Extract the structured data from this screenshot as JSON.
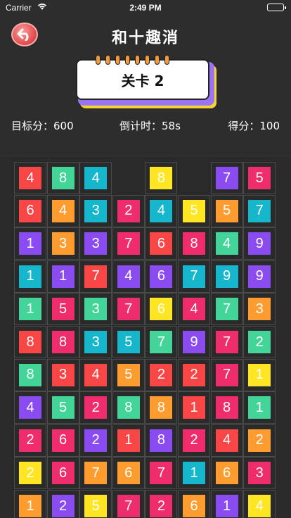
{
  "status_bar": {
    "carrier": "Carrier",
    "time": "2:49 PM"
  },
  "nav": {
    "title": "和十趣消"
  },
  "level": {
    "label": "关卡 2"
  },
  "stats": {
    "target": "目标分：600",
    "timer": "倒计时：58s",
    "score": "得分：100"
  },
  "palette": {
    "1": "#2cbce0",
    "2": "#ef2d6d",
    "3": "#ff9c2f",
    "4": "#8a4cf0",
    "5": "#43d49a",
    "6": "#f84545",
    "7": "#8a4cf0",
    "8": "#ffe522",
    "9": "#8a4cf0"
  },
  "board": {
    "rows": [
      [
        {
          "v": "4",
          "c": "#f84545"
        },
        {
          "v": "8",
          "c": "#43d49a"
        },
        {
          "v": "4",
          "c": "#16b6cc"
        },
        null,
        {
          "v": "8",
          "c": "#ffe522"
        },
        null,
        {
          "v": "7",
          "c": "#8a4cf0"
        },
        {
          "v": "5",
          "c": "#ef2d6d"
        }
      ],
      [
        {
          "v": "6",
          "c": "#f84545"
        },
        {
          "v": "4",
          "c": "#ff9c2f"
        },
        {
          "v": "3",
          "c": "#16b6cc"
        },
        {
          "v": "2",
          "c": "#ef2d6d"
        },
        {
          "v": "4",
          "c": "#16b6cc"
        },
        {
          "v": "5",
          "c": "#ffe522"
        },
        {
          "v": "5",
          "c": "#ff9c2f"
        },
        {
          "v": "7",
          "c": "#16b6cc"
        }
      ],
      [
        {
          "v": "1",
          "c": "#8a4cf0"
        },
        {
          "v": "3",
          "c": "#ff9c2f"
        },
        {
          "v": "3",
          "c": "#8a4cf0"
        },
        {
          "v": "7",
          "c": "#ef2d6d"
        },
        {
          "v": "6",
          "c": "#f84545"
        },
        {
          "v": "8",
          "c": "#ef2d6d"
        },
        {
          "v": "4",
          "c": "#43d49a"
        },
        {
          "v": "9",
          "c": "#8a4cf0"
        }
      ],
      [
        {
          "v": "1",
          "c": "#16b6cc"
        },
        {
          "v": "1",
          "c": "#8a4cf0"
        },
        {
          "v": "7",
          "c": "#f84545"
        },
        {
          "v": "4",
          "c": "#8a4cf0"
        },
        {
          "v": "6",
          "c": "#8a4cf0"
        },
        {
          "v": "7",
          "c": "#16b6cc"
        },
        {
          "v": "9",
          "c": "#16b6cc"
        },
        {
          "v": "9",
          "c": "#8a4cf0"
        }
      ],
      [
        {
          "v": "1",
          "c": "#43d49a"
        },
        {
          "v": "5",
          "c": "#ef2d6d"
        },
        {
          "v": "3",
          "c": "#43d49a"
        },
        {
          "v": "7",
          "c": "#ef2d6d"
        },
        {
          "v": "6",
          "c": "#ffe522"
        },
        {
          "v": "4",
          "c": "#ef2d6d"
        },
        {
          "v": "7",
          "c": "#43d49a"
        },
        {
          "v": "3",
          "c": "#ff9c2f"
        }
      ],
      [
        {
          "v": "8",
          "c": "#f84545"
        },
        {
          "v": "8",
          "c": "#ef2d6d"
        },
        {
          "v": "3",
          "c": "#16b6cc"
        },
        {
          "v": "5",
          "c": "#16b6cc"
        },
        {
          "v": "7",
          "c": "#43d49a"
        },
        {
          "v": "9",
          "c": "#8a4cf0"
        },
        {
          "v": "7",
          "c": "#ef2d6d"
        },
        {
          "v": "2",
          "c": "#43d49a"
        }
      ],
      [
        {
          "v": "8",
          "c": "#43d49a"
        },
        {
          "v": "3",
          "c": "#f84545"
        },
        {
          "v": "4",
          "c": "#f84545"
        },
        {
          "v": "5",
          "c": "#ff9c2f"
        },
        {
          "v": "2",
          "c": "#f84545"
        },
        {
          "v": "2",
          "c": "#f84545"
        },
        {
          "v": "7",
          "c": "#ef2d6d"
        },
        {
          "v": "1",
          "c": "#ffe522"
        }
      ],
      [
        {
          "v": "4",
          "c": "#8a4cf0"
        },
        {
          "v": "5",
          "c": "#43d49a"
        },
        {
          "v": "2",
          "c": "#ef2d6d"
        },
        {
          "v": "8",
          "c": "#43d49a"
        },
        {
          "v": "8",
          "c": "#ff9c2f"
        },
        {
          "v": "1",
          "c": "#f84545"
        },
        {
          "v": "8",
          "c": "#ef2d6d"
        },
        {
          "v": "1",
          "c": "#43d49a"
        }
      ],
      [
        {
          "v": "2",
          "c": "#ef2d6d"
        },
        {
          "v": "6",
          "c": "#ef2d6d"
        },
        {
          "v": "2",
          "c": "#8a4cf0"
        },
        {
          "v": "1",
          "c": "#f84545"
        },
        {
          "v": "8",
          "c": "#8a4cf0"
        },
        {
          "v": "2",
          "c": "#ef2d6d"
        },
        {
          "v": "4",
          "c": "#f84545"
        },
        {
          "v": "2",
          "c": "#ff9c2f"
        }
      ],
      [
        {
          "v": "2",
          "c": "#ffe522"
        },
        {
          "v": "6",
          "c": "#ef2d6d"
        },
        {
          "v": "7",
          "c": "#ff9c2f"
        },
        {
          "v": "6",
          "c": "#ff9c2f"
        },
        {
          "v": "7",
          "c": "#ef2d6d"
        },
        {
          "v": "1",
          "c": "#16b6cc"
        },
        {
          "v": "6",
          "c": "#ff9c2f"
        },
        {
          "v": "3",
          "c": "#ef2d6d"
        }
      ],
      [
        {
          "v": "1",
          "c": "#ff9c2f"
        },
        {
          "v": "2",
          "c": "#8a4cf0"
        },
        {
          "v": "5",
          "c": "#ffe522"
        },
        {
          "v": "7",
          "c": "#ef2d6d"
        },
        {
          "v": "2",
          "c": "#ef2d6d"
        },
        {
          "v": "6",
          "c": "#ff9c2f"
        },
        {
          "v": "1",
          "c": "#8a4cf0"
        },
        {
          "v": "4",
          "c": "#ffe522"
        }
      ]
    ]
  }
}
